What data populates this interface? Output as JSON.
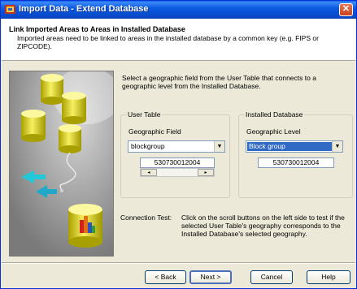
{
  "window": {
    "title": "Import Data - Extend Database",
    "close_glyph": "✕"
  },
  "header": {
    "title": "Link Imported Areas to Areas in Installed Database",
    "description": "Imported areas need to be linked to areas in the installed database by a common key (e.g. FIPS or ZIPCODE)."
  },
  "intro_text": "Select a geographic field from the User Table that connects to a geographic level from the Installed Database.",
  "user_table": {
    "group_label": "User Table",
    "field_label": "Geographic Field",
    "selected_value": "blockgroup",
    "key_value": "530730012004",
    "scroll_left_glyph": "◂",
    "scroll_right_glyph": "▸"
  },
  "installed_db": {
    "group_label": "Installed Database",
    "field_label": "Geographic Level",
    "selected_value": "Block group",
    "key_value": "530730012004"
  },
  "connection_test": {
    "label": "Connection Test:",
    "description": "Click on the scroll buttons on the left side to test if the selected User Table's geography corresponds to the Installed Database's selected geography."
  },
  "buttons": {
    "back": "< Back",
    "next": "Next >",
    "cancel": "Cancel",
    "help": "Help"
  },
  "dropdown_arrow_glyph": "▼",
  "colors": {
    "title_bar": "#0a5ae0",
    "selection": "#316ac5",
    "dialog_bg": "#ece9d8"
  },
  "icons": [
    "app-icon",
    "close-icon",
    "dropdown-arrow-icon",
    "scroll-left-icon",
    "scroll-right-icon",
    "database-illustration"
  ]
}
